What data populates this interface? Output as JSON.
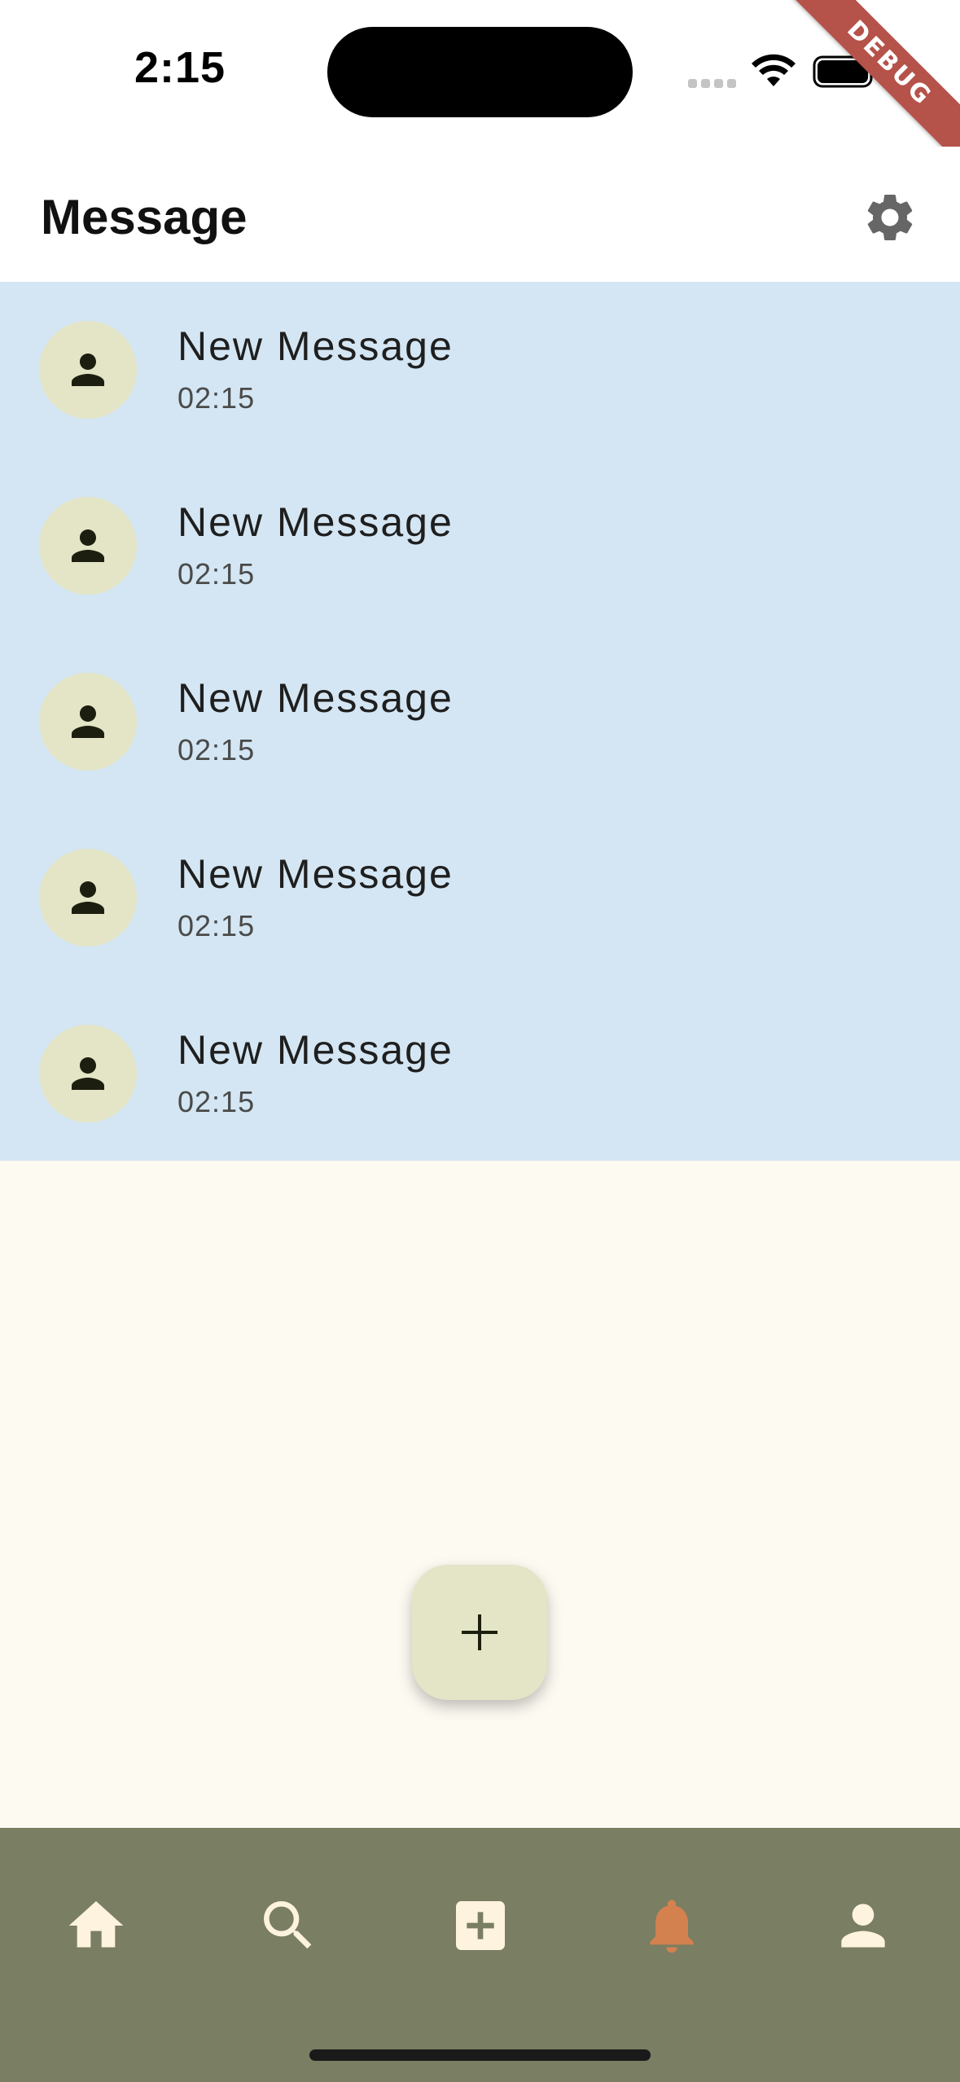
{
  "status_bar": {
    "time": "2:15"
  },
  "debug_banner": "DEBUG",
  "header": {
    "title": "Message",
    "settings_icon": "gear-icon"
  },
  "messages": [
    {
      "title": "New Message",
      "time": "02:15"
    },
    {
      "title": "New Message",
      "time": "02:15"
    },
    {
      "title": "New Message",
      "time": "02:15"
    },
    {
      "title": "New Message",
      "time": "02:15"
    },
    {
      "title": "New Message",
      "time": "02:15"
    }
  ],
  "fab": {
    "icon": "plus-icon"
  },
  "bottom_nav": {
    "items": [
      {
        "icon": "home-icon",
        "active": false
      },
      {
        "icon": "search-icon",
        "active": false
      },
      {
        "icon": "add-box-icon",
        "active": false
      },
      {
        "icon": "bell-icon",
        "active": true
      },
      {
        "icon": "person-icon",
        "active": false
      }
    ]
  },
  "colors": {
    "list_background": "#d4e6f3",
    "page_background": "#fdfaf2",
    "avatar_background": "#e3e5c6",
    "nav_background": "#7a7e62",
    "nav_icon": "#fdf3df",
    "nav_active": "#d3814f",
    "debug_ribbon": "#b5524a"
  }
}
